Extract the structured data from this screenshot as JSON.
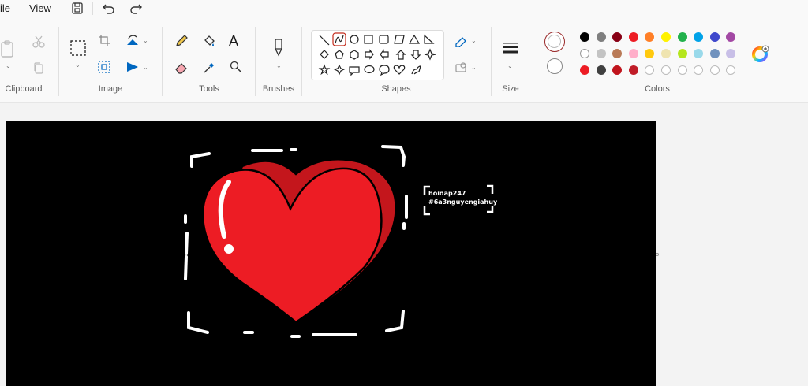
{
  "menu": {
    "file": "ile",
    "view": "View"
  },
  "groups": {
    "clipboard": "Clipboard",
    "image": "Image",
    "tools": "Tools",
    "brushes": "Brushes",
    "shapes": "Shapes",
    "size": "Size",
    "colors": "Colors"
  },
  "canvas": {
    "watermark_line1": "hoidap247",
    "watermark_line2": "#6a3nguyengiahuy"
  },
  "palette": {
    "row1": [
      "#000000",
      "#7f7f7f",
      "#880015",
      "#ed1c24",
      "#ff7f27",
      "#fff200",
      "#22b14c",
      "#00a2e8",
      "#3f48cc",
      "#a349a4"
    ],
    "row2": [
      "#ffffff",
      "#c3c3c3",
      "#b97a57",
      "#ffaec9",
      "#ffc90e",
      "#efe4b0",
      "#b5e61d",
      "#99d9ea",
      "#7092be",
      "#c8bfe7"
    ],
    "row3": [
      "#ed1c24",
      "#404040",
      "#c0141c",
      "#c01c28",
      "",
      "",
      "",
      "",
      "",
      ""
    ],
    "primary": "#ed1c24",
    "secondary": "#ffffff"
  }
}
